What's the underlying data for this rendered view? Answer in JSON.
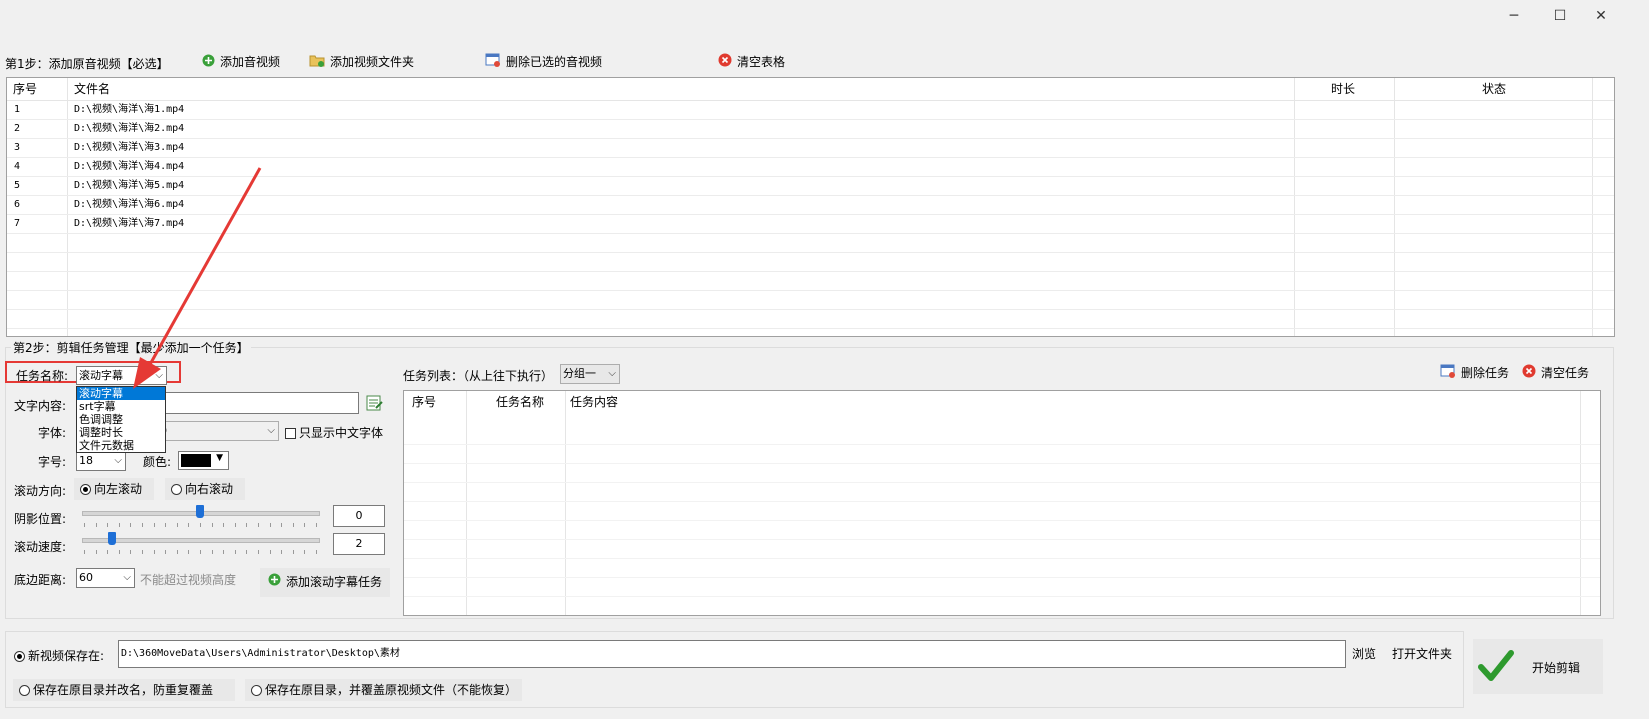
{
  "window": {
    "controls": [
      "─",
      "☐",
      "✕"
    ]
  },
  "step1": {
    "title": "第1步：添加原音视频【必选】",
    "buttons": {
      "add_media": "添加音视频",
      "add_folder": "添加视频文件夹",
      "delete_selected": "删除已选的音视频",
      "clear_table": "清空表格"
    },
    "columns": [
      "序号",
      "文件名",
      "时长",
      "状态"
    ],
    "rows": [
      {
        "no": "1",
        "file": "D:\\视频\\海洋\\海1.mp4"
      },
      {
        "no": "2",
        "file": "D:\\视频\\海洋\\海2.mp4"
      },
      {
        "no": "3",
        "file": "D:\\视频\\海洋\\海3.mp4"
      },
      {
        "no": "4",
        "file": "D:\\视频\\海洋\\海4.mp4"
      },
      {
        "no": "5",
        "file": "D:\\视频\\海洋\\海5.mp4"
      },
      {
        "no": "6",
        "file": "D:\\视频\\海洋\\海6.mp4"
      },
      {
        "no": "7",
        "file": "D:\\视频\\海洋\\海7.mp4"
      }
    ]
  },
  "step2": {
    "title": "第2步：剪辑任务管理【最少添加一个任务】",
    "task_name_label": "任务名称:",
    "task_name_value": "滚动字幕",
    "task_options": [
      "滚动字幕",
      "srt字幕",
      "色调调整",
      "调整时长",
      "文件元数据"
    ],
    "text_content_label": "文字内容:",
    "font_label": "字体:",
    "font_value_fragment": "）",
    "only_chinese_label": "只显示中文字体",
    "size_label": "字号:",
    "size_value": "18",
    "color_label": "颜色:",
    "color_value": "#000000",
    "direction_label": "滚动方向:",
    "dir_left": "向左滚动",
    "dir_right": "向右滚动",
    "shadow_label": "阴影位置:",
    "shadow_value": "0",
    "speed_label": "滚动速度:",
    "speed_value": "2",
    "bottom_label": "底边距离:",
    "bottom_value": "60",
    "bottom_hint": "不能超过视频高度",
    "add_task_button": "添加滚动字幕任务",
    "task_list_label": "任务列表：（从上往下执行）",
    "group_value": "分组一",
    "delete_task": "删除任务",
    "clear_tasks": "清空任务",
    "task_columns": [
      "序号",
      "任务名称",
      "任务内容"
    ]
  },
  "output": {
    "save_new_label": "新视频保存在:",
    "save_path": "D:\\360MoveData\\Users\\Administrator\\Desktop\\素材",
    "browse": "浏览",
    "open_folder": "打开文件夹",
    "save_rename": "保存在原目录并改名，防重复覆盖",
    "save_overwrite": "保存在原目录，并覆盖原视频文件（不能恢复）",
    "start": "开始剪辑"
  },
  "colors": {
    "highlight": "#e53935",
    "accent": "#0078d7",
    "check": "#2e9a2e"
  }
}
